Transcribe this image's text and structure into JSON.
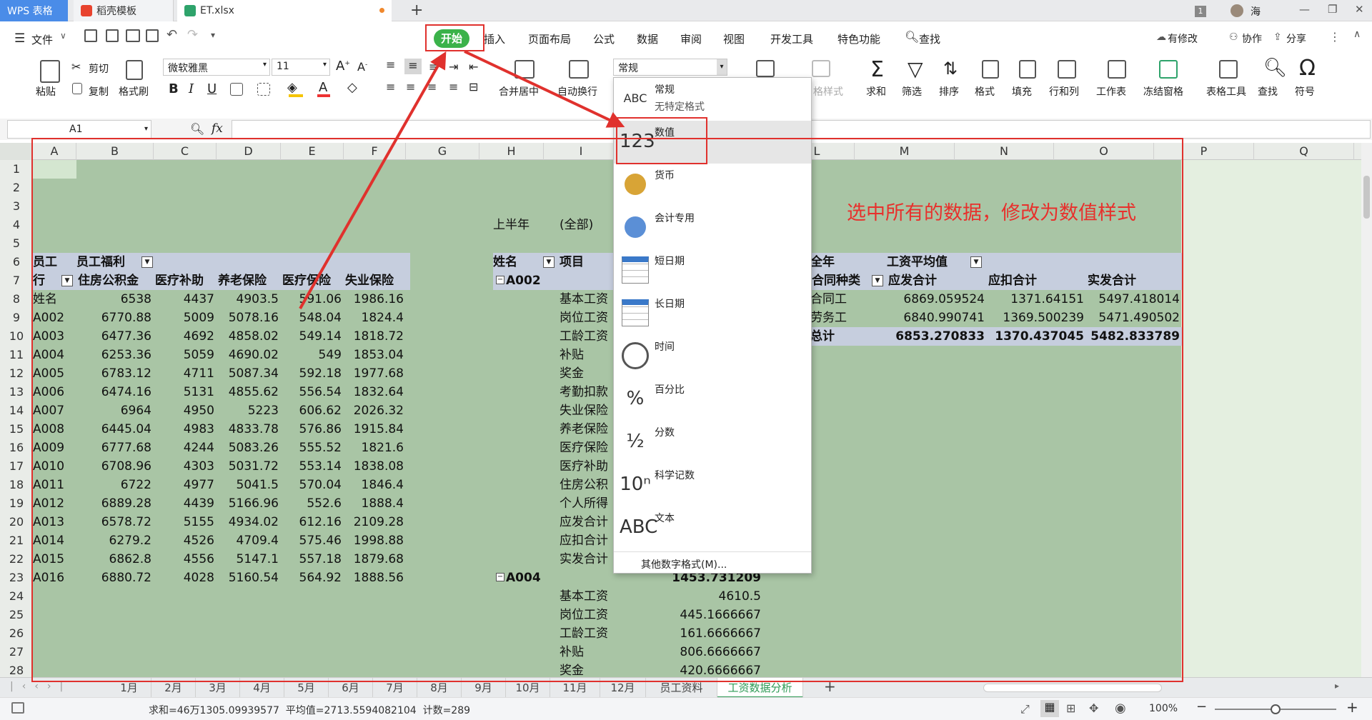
{
  "window": {
    "tabs": [
      {
        "label": "WPS 表格"
      },
      {
        "label": "稻壳模板"
      },
      {
        "label": "ET.xlsx"
      }
    ],
    "new_tab_label": "+",
    "badge": "1",
    "user": "海",
    "controls": [
      "—",
      "❐",
      "✕"
    ]
  },
  "menubar": {
    "file_label": "文件",
    "tabs": [
      "开始",
      "插入",
      "页面布局",
      "公式",
      "数据",
      "审阅",
      "视图",
      "开发工具",
      "特色功能"
    ],
    "search_label": "查找",
    "right": [
      "有修改",
      "协作",
      "分享"
    ]
  },
  "ribbon": {
    "paste": "粘贴",
    "cut": "剪切",
    "copy": "复制",
    "format_painter": "格式刷",
    "font_name": "微软雅黑",
    "font_size": "11",
    "merge": "合并居中",
    "wrap": "自动换行",
    "number_format": "常规",
    "cond_format": "格样式",
    "sum": "求和",
    "filter": "筛选",
    "sort": "排序",
    "format": "格式",
    "fill": "填充",
    "rowcol": "行和列",
    "sheet": "工作表",
    "freeze": "冻结窗格",
    "table_tools": "表格工具",
    "find": "查找",
    "symbol": "符号"
  },
  "formula_bar": {
    "name_box": "A1",
    "fx": "fx",
    "value": ""
  },
  "columns": [
    "A",
    "B",
    "C",
    "D",
    "E",
    "F",
    "G",
    "H",
    "I",
    "",
    "",
    "",
    "L",
    "M",
    "N",
    "O",
    "P",
    "Q"
  ],
  "rows": [
    "1",
    "2",
    "3",
    "4",
    "5",
    "6",
    "7",
    "8",
    "9",
    "10",
    "11",
    "12",
    "13",
    "14",
    "15",
    "16",
    "17",
    "18",
    "19",
    "20",
    "21",
    "22",
    "23",
    "24",
    "25",
    "26",
    "27",
    "28"
  ],
  "left_table": {
    "h1": [
      "员工",
      "员工福利"
    ],
    "h2": [
      "行",
      "住房公积金",
      "医疗补助",
      "养老保险",
      "医疗保险",
      "失业保险"
    ],
    "rows": [
      [
        "姓名",
        "6538",
        "4437",
        "4903.5",
        "591.06",
        "1986.16"
      ],
      [
        "A002",
        "6770.88",
        "5009",
        "5078.16",
        "548.04",
        "1824.4"
      ],
      [
        "A003",
        "6477.36",
        "4692",
        "4858.02",
        "549.14",
        "1818.72"
      ],
      [
        "A004",
        "6253.36",
        "5059",
        "4690.02",
        "549",
        "1853.04"
      ],
      [
        "A005",
        "6783.12",
        "4711",
        "5087.34",
        "592.18",
        "1977.68"
      ],
      [
        "A006",
        "6474.16",
        "5131",
        "4855.62",
        "556.54",
        "1832.64"
      ],
      [
        "A007",
        "6964",
        "4950",
        "5223",
        "606.62",
        "2026.32"
      ],
      [
        "A008",
        "6445.04",
        "4983",
        "4833.78",
        "576.86",
        "1915.84"
      ],
      [
        "A009",
        "6777.68",
        "4244",
        "5083.26",
        "555.52",
        "1821.6"
      ],
      [
        "A010",
        "6708.96",
        "4303",
        "5031.72",
        "553.14",
        "1838.08"
      ],
      [
        "A011",
        "6722",
        "4977",
        "5041.5",
        "570.04",
        "1846.4"
      ],
      [
        "A012",
        "6889.28",
        "4439",
        "5166.96",
        "552.6",
        "1888.4"
      ],
      [
        "A013",
        "6578.72",
        "5155",
        "4934.02",
        "612.16",
        "2109.28"
      ],
      [
        "A014",
        "6279.2",
        "4526",
        "4709.4",
        "575.46",
        "1998.88"
      ],
      [
        "A015",
        "6862.8",
        "4556",
        "5147.1",
        "557.18",
        "1879.68"
      ],
      [
        "A016",
        "6880.72",
        "4028",
        "5160.54",
        "564.92",
        "1888.56"
      ]
    ]
  },
  "mid_table": {
    "filter_label": "上半年",
    "filter_value": "(全部)",
    "h_name": "姓名",
    "h_item": "项目",
    "group1": "A002",
    "items1": [
      "基本工资",
      "岗位工资",
      "工龄工资",
      "补贴",
      "奖金",
      "考勤扣款",
      "失业保险",
      "养老保险",
      "医疗保险",
      "医疗补助",
      "住房公积",
      "个人所得",
      "应发合计",
      "应扣合计",
      "实发合计"
    ],
    "group2": "A004",
    "group2_value": "1453.731209",
    "items2": [
      [
        "基本工资",
        "4610.5"
      ],
      [
        "岗位工资",
        "445.1666667"
      ],
      [
        "工龄工资",
        "161.6666667"
      ],
      [
        "补贴",
        "806.6666667"
      ],
      [
        "奖金",
        "420.6666667"
      ]
    ]
  },
  "right_table": {
    "h1": [
      "全年",
      "工资平均值"
    ],
    "h2": [
      "合同种类",
      "应发合计",
      "应扣合计",
      "实发合计"
    ],
    "rows": [
      [
        "合同工",
        "6869.059524",
        "1371.64151",
        "5497.418014"
      ],
      [
        "劳务工",
        "6840.990741",
        "1369.500239",
        "5471.490502"
      ]
    ],
    "total": [
      "总计",
      "6853.270833",
      "1370.437045",
      "5482.833789"
    ]
  },
  "number_format_menu": {
    "items": [
      {
        "icon": "ABC 123",
        "title": "常规",
        "sub": "无特定格式"
      },
      {
        "icon": "123",
        "title": "数值",
        "sub": ""
      },
      {
        "icon": "coins",
        "title": "货币",
        "sub": ""
      },
      {
        "icon": "calc-coins",
        "title": "会计专用",
        "sub": ""
      },
      {
        "icon": "calendar",
        "title": "短日期",
        "sub": ""
      },
      {
        "icon": "calendar",
        "title": "长日期",
        "sub": ""
      },
      {
        "icon": "clock",
        "title": "时间",
        "sub": ""
      },
      {
        "icon": "%",
        "title": "百分比",
        "sub": ""
      },
      {
        "icon": "½",
        "title": "分数",
        "sub": ""
      },
      {
        "icon": "10ⁿ",
        "title": "科学记数",
        "sub": ""
      },
      {
        "icon": "ABC",
        "title": "文本",
        "sub": ""
      }
    ],
    "more": "其他数字格式(M)..."
  },
  "annotation": "选中所有的数据，修改为数值样式",
  "sheet_tabs": [
    "1月",
    "2月",
    "3月",
    "4月",
    "5月",
    "6月",
    "7月",
    "8月",
    "9月",
    "10月",
    "11月",
    "12月",
    "员工资料",
    "工资数据分析"
  ],
  "status": {
    "text": "求和=46万1305.09939577  平均值=2713.5594082104  计数=289",
    "zoom": "100%"
  },
  "colors": {
    "selection": "#a9c5a5",
    "accent_green": "#3bb24a",
    "annotation_red": "#e0312d"
  }
}
